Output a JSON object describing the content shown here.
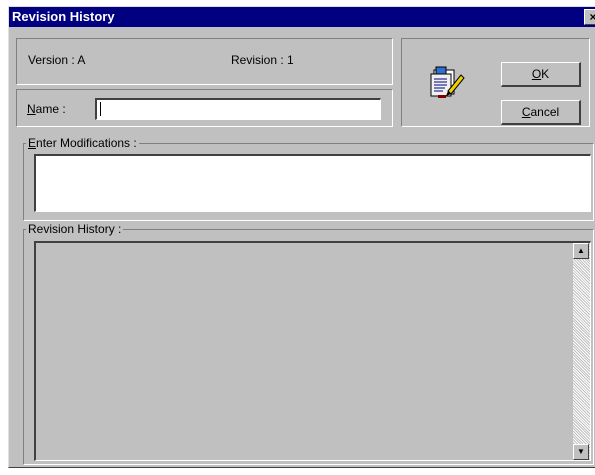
{
  "window": {
    "title": "Revision History",
    "close_glyph": "×"
  },
  "info": {
    "version_label": "Version : A",
    "revision_label": "Revision : 1"
  },
  "name": {
    "label_prefix": "",
    "label_hotkey": "N",
    "label_rest": "ame :",
    "value": ""
  },
  "buttons": {
    "ok": {
      "hotkey": "O",
      "rest": "K"
    },
    "cancel": {
      "hotkey": "C",
      "rest": "ancel"
    }
  },
  "modifications": {
    "hotkey": "E",
    "rest": "nter Modifications :",
    "value": ""
  },
  "history": {
    "title": "Revision History :"
  },
  "scrollbar": {
    "up_glyph": "▲",
    "down_glyph": "▼"
  },
  "icons": {
    "dialog_icon": "document-edit-icon"
  }
}
